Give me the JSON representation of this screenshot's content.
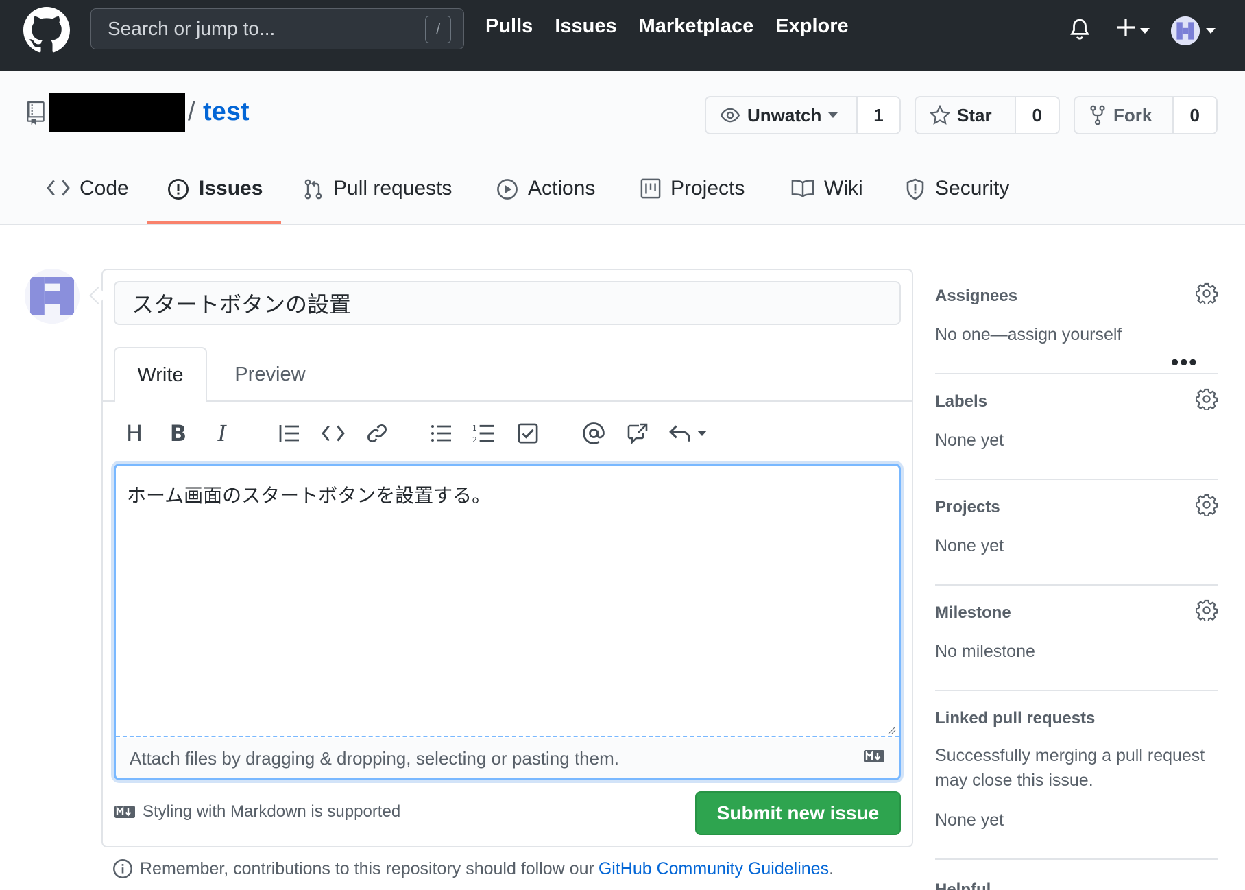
{
  "header": {
    "search_placeholder": "Search or jump to...",
    "search_shortcut": "/",
    "nav": [
      "Pulls",
      "Issues",
      "Marketplace",
      "Explore"
    ]
  },
  "repo": {
    "separator": "/",
    "name": "test",
    "watch_label": "Unwatch",
    "watch_count": "1",
    "star_label": "Star",
    "star_count": "0",
    "fork_label": "Fork",
    "fork_count": "0"
  },
  "tabs": {
    "code": "Code",
    "issues": "Issues",
    "pulls": "Pull requests",
    "actions": "Actions",
    "projects": "Projects",
    "wiki": "Wiki",
    "security": "Security",
    "more": "•••"
  },
  "composer": {
    "title_value": "スタートボタンの設置",
    "tab_write": "Write",
    "tab_preview": "Preview",
    "toolbar": {
      "heading": "H",
      "bold": "B",
      "italic": "I"
    },
    "body_value": "ホーム画面のスタートボタンを設置する。",
    "attach_text": "Attach files by dragging & dropping, selecting or pasting them.",
    "markdown_note": "Styling with Markdown is supported",
    "submit_label": "Submit new issue",
    "guidelines_prefix": "Remember, contributions to this repository should follow our ",
    "guidelines_link": "GitHub Community Guidelines",
    "guidelines_suffix": "."
  },
  "sidebar": {
    "assignees_title": "Assignees",
    "assignees_value": "No one—assign yourself",
    "labels_title": "Labels",
    "labels_value": "None yet",
    "projects_title": "Projects",
    "projects_value": "None yet",
    "milestone_title": "Milestone",
    "milestone_value": "No milestone",
    "linked_title": "Linked pull requests",
    "linked_desc_line1": "Successfully merging a pull request",
    "linked_desc_line2": "may close this issue.",
    "linked_value": "None yet",
    "next_title_partial": "Helpful"
  },
  "colors": {
    "header_bg": "#24292e",
    "link": "#0366d6",
    "primary_button": "#2ea44f",
    "active_tab_underline": "#f9826c"
  },
  "icons": [
    "github-mark-icon",
    "bell-icon",
    "plus-icon",
    "repo-icon",
    "eye-icon",
    "star-icon",
    "fork-icon",
    "code-icon",
    "issue-icon",
    "pull-request-icon",
    "play-icon",
    "project-icon",
    "book-icon",
    "shield-icon",
    "gear-icon",
    "markdown-icon",
    "info-icon"
  ]
}
